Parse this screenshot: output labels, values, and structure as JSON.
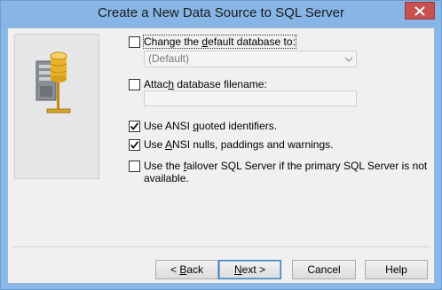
{
  "window": {
    "title": "Create a New Data Source to SQL Server",
    "close_icon": "close-icon"
  },
  "art": {
    "icon": "database-server-icon"
  },
  "options": {
    "change_db": {
      "pre": "Change the ",
      "accel": "d",
      "post": "efault database to:",
      "checked": false
    },
    "default_db_select": {
      "value": "(Default)",
      "enabled": false
    },
    "attach_db": {
      "pre": "Attac",
      "accel": "h",
      "post": " database filename:",
      "checked": false
    },
    "attach_db_input": {
      "value": "",
      "enabled": false
    },
    "ansi_quoted": {
      "pre": "Use ANSI ",
      "accel": "q",
      "post": "uoted identifiers.",
      "checked": true
    },
    "ansi_nulls": {
      "pre": "Use ",
      "accel": "A",
      "post": "NSI nulls, paddings and warnings.",
      "checked": true
    },
    "failover": {
      "line1_pre": "Use the ",
      "line1_accel": "f",
      "line1_post": "ailover SQL Server if the primary SQL Server is not",
      "line2": "available.",
      "checked": false
    }
  },
  "buttons": {
    "back": {
      "pre": "< ",
      "accel": "B",
      "post": "ack"
    },
    "next": {
      "pre": "",
      "accel": "N",
      "post": "ext >"
    },
    "cancel": "Cancel",
    "help": "Help"
  },
  "colors": {
    "frame": "#88b8e8",
    "close": "#c75050",
    "dialog_bg": "#f0f0f0"
  }
}
